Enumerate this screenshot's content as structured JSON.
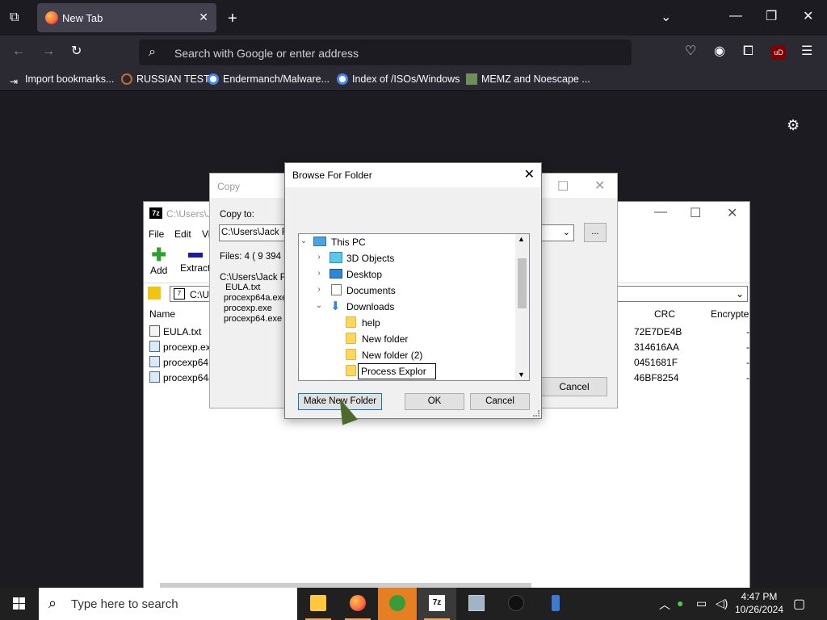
{
  "browser": {
    "tab_title": "New Tab",
    "url_placeholder": "Search with Google or enter address",
    "bookmarks": [
      "Import bookmarks...",
      "RUSSIAN TEST",
      "Endermanch/Malware...",
      "Index of /ISOs/Windows",
      "MEMZ and Noescape ..."
    ]
  },
  "sevenzip": {
    "title": "C:\\Users\\J",
    "menu": [
      "File",
      "Edit",
      "Vi"
    ],
    "tools": [
      "Add",
      "Extract"
    ],
    "address": "C:\\Us",
    "columns": {
      "name": "Name",
      "crc": "CRC",
      "encrypted": "Encrypte"
    },
    "files": [
      {
        "name": "EULA.txt",
        "crc": "72E7DE4B",
        "enc": "-",
        "type": "txt"
      },
      {
        "name": "procexp.ex",
        "crc": "314616AA",
        "enc": "-",
        "type": "exe"
      },
      {
        "name": "procexp64.",
        "crc": "0451681F",
        "enc": "-",
        "type": "exe"
      },
      {
        "name": "procexp64a",
        "crc": "46BF8254",
        "enc": "-",
        "type": "exe"
      }
    ]
  },
  "copy_dialog": {
    "title": "Copy",
    "copy_to_label": "Copy to:",
    "path": "C:\\Users\\Jack F",
    "browse_label": "...",
    "files_info": "Files: 4   ( 9 394",
    "source_path": "C:\\Users\\Jack F",
    "list": [
      "EULA.txt",
      "procexp64a.exe",
      "procexp.exe",
      "procexp64.exe"
    ],
    "cancel_label": "Cancel"
  },
  "browse_dialog": {
    "title": "Browse For Folder",
    "tree": {
      "this_pc": "This PC",
      "objects3d": "3D Objects",
      "desktop": "Desktop",
      "documents": "Documents",
      "downloads": "Downloads",
      "help": "help",
      "new_folder": "New folder",
      "new_folder2": "New folder (2)"
    },
    "edit_value": "Process Explor",
    "make_new_folder_label": "Make New Folder",
    "ok_label": "OK",
    "cancel_label": "Cancel"
  },
  "taskbar": {
    "search_placeholder": "Type here to search",
    "time": "4:47 PM",
    "date": "10/26/2024"
  }
}
